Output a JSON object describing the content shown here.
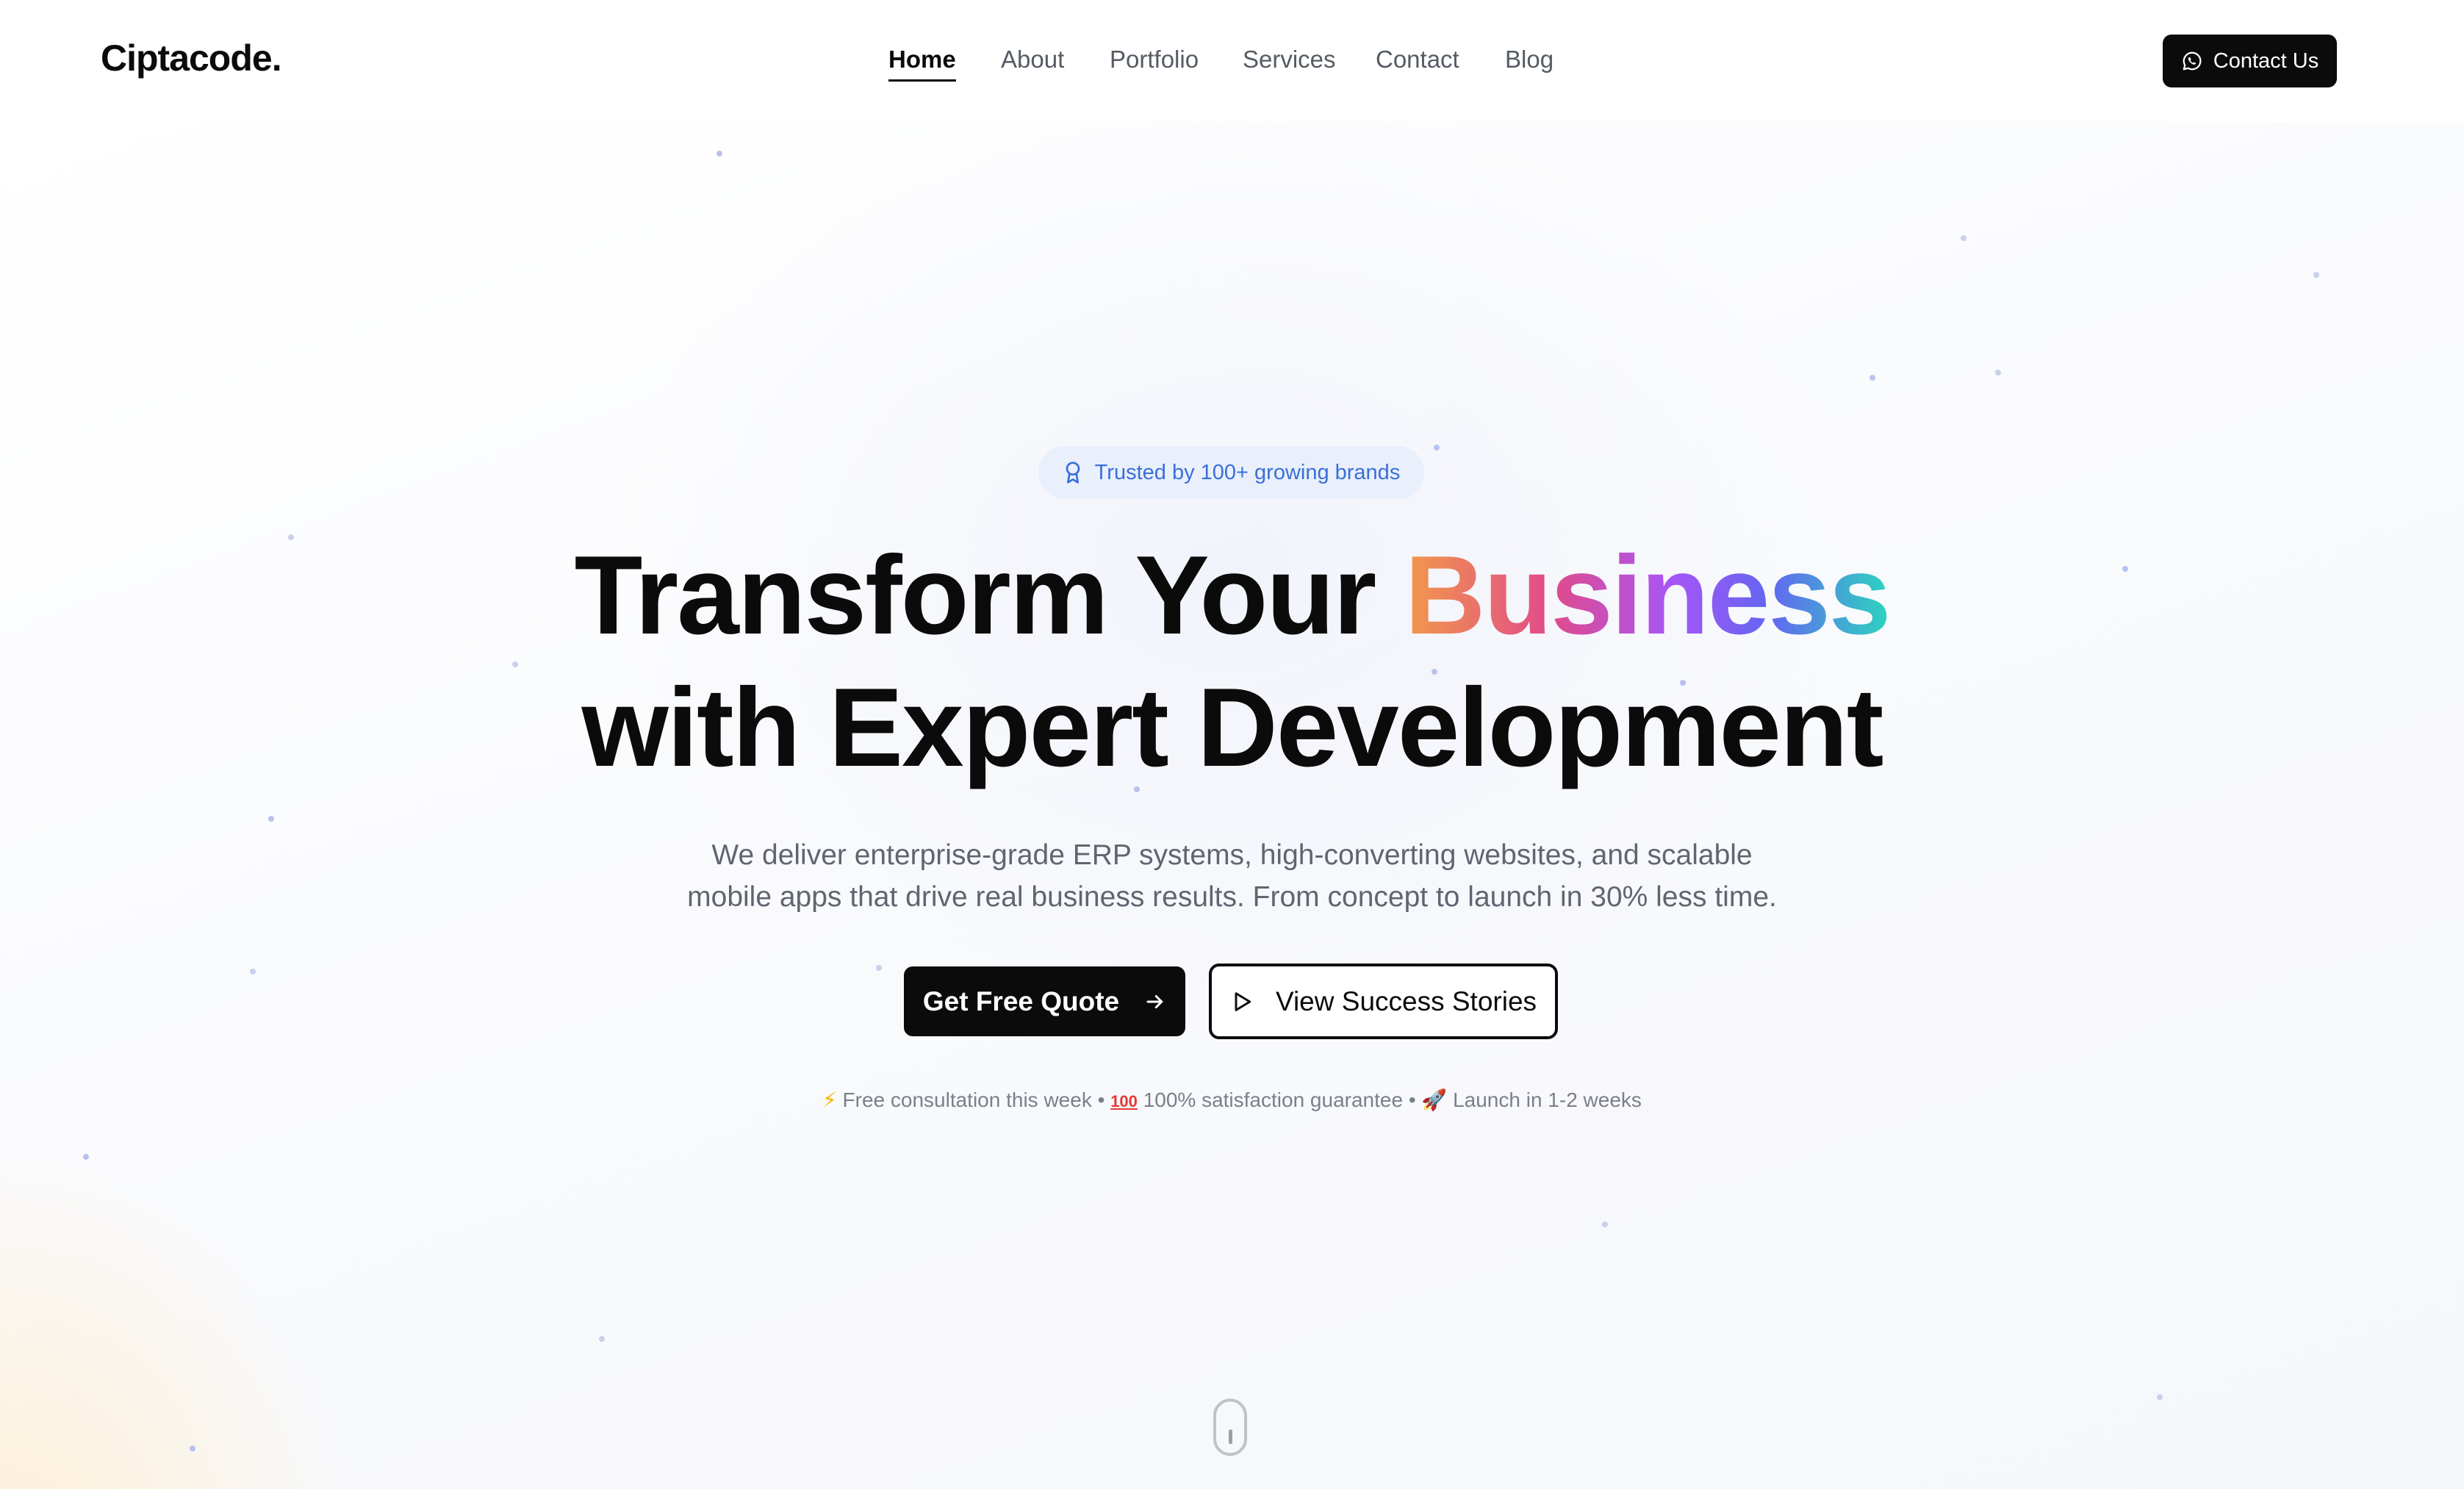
{
  "header": {
    "logo": "Ciptacode.",
    "nav": [
      {
        "label": "Home",
        "active": true
      },
      {
        "label": "About",
        "active": false
      },
      {
        "label": "Portfolio",
        "active": false
      },
      {
        "label": "Services",
        "active": false
      },
      {
        "label": "Contact",
        "active": false
      },
      {
        "label": "Blog",
        "active": false
      }
    ],
    "cta_label": "Contact Us",
    "cta_icon": "whatsapp-icon"
  },
  "hero": {
    "badge_text": "Trusted by 100+ growing brands",
    "badge_icon": "award-icon",
    "headline_part1": "Transform Your ",
    "headline_highlight": "Business",
    "headline_part2": "with Expert Development",
    "subtitle_line1": "We deliver enterprise-grade ERP systems, high-converting websites, and scalable",
    "subtitle_line2": "mobile apps that drive real business results. From concept to launch in 30% less time.",
    "primary_button": "Get Free Quote",
    "secondary_button": "View Success Stories",
    "perks": {
      "item1_icon": "⚡",
      "item1": "Free consultation this week",
      "separator": "•",
      "item2_icon": "100",
      "item2": "100% satisfaction guarantee",
      "item3_icon": "🚀",
      "item3": "Launch in 1-2 weeks"
    }
  },
  "colors": {
    "accent": "#0b0b0b",
    "badge_bg": "#e9effb",
    "badge_text": "#3a6fd8",
    "gradient": [
      "#f2994a",
      "#e14b8a",
      "#a855f7",
      "#6366f1",
      "#2dd4bf"
    ]
  }
}
